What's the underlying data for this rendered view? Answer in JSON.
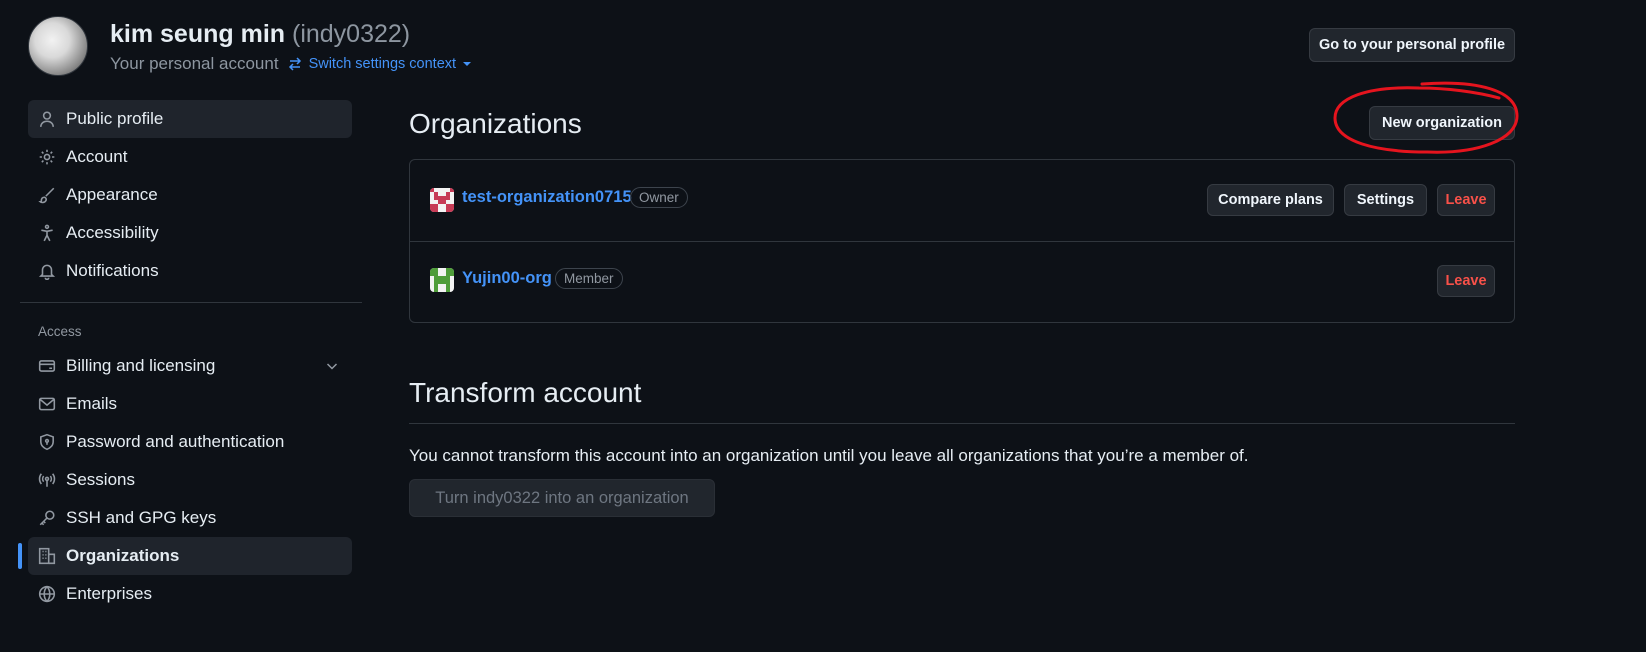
{
  "header": {
    "name": "kim seung min",
    "handle": "(indy0322)",
    "subtitle": "Your personal account",
    "switch_context": "Switch settings context",
    "profile_button": "Go to your personal profile"
  },
  "sidebar": {
    "items_top": [
      {
        "label": "Public profile",
        "icon": "person-icon"
      },
      {
        "label": "Account",
        "icon": "gear-icon"
      },
      {
        "label": "Appearance",
        "icon": "paintbrush-icon"
      },
      {
        "label": "Accessibility",
        "icon": "accessibility-icon"
      },
      {
        "label": "Notifications",
        "icon": "bell-icon"
      }
    ],
    "section_access": "Access",
    "items_access": [
      {
        "label": "Billing and licensing",
        "icon": "credit-card-icon"
      },
      {
        "label": "Emails",
        "icon": "mail-icon"
      },
      {
        "label": "Password and authentication",
        "icon": "shield-lock-icon"
      },
      {
        "label": "Sessions",
        "icon": "broadcast-icon"
      },
      {
        "label": "SSH and GPG keys",
        "icon": "key-icon"
      },
      {
        "label": "Organizations",
        "icon": "organization-icon"
      },
      {
        "label": "Enterprises",
        "icon": "globe-icon"
      }
    ]
  },
  "main": {
    "orgs_title": "Organizations",
    "new_org_button": "New organization",
    "orgs": [
      {
        "name": "test-organization0715",
        "role": "Owner",
        "compare": "Compare plans",
        "settings": "Settings",
        "leave": "Leave"
      },
      {
        "name": "Yujin00-org",
        "role": "Member",
        "leave": "Leave"
      }
    ],
    "transform_title": "Transform account",
    "transform_text": "You cannot transform this account into an organization until you leave all organizations that you’re a member of.",
    "transform_button": "Turn indy0322 into an organization"
  },
  "colors": {
    "background": "#0d1117",
    "link": "#4493f8",
    "danger": "#f85149",
    "annotation": "#e5141e"
  }
}
